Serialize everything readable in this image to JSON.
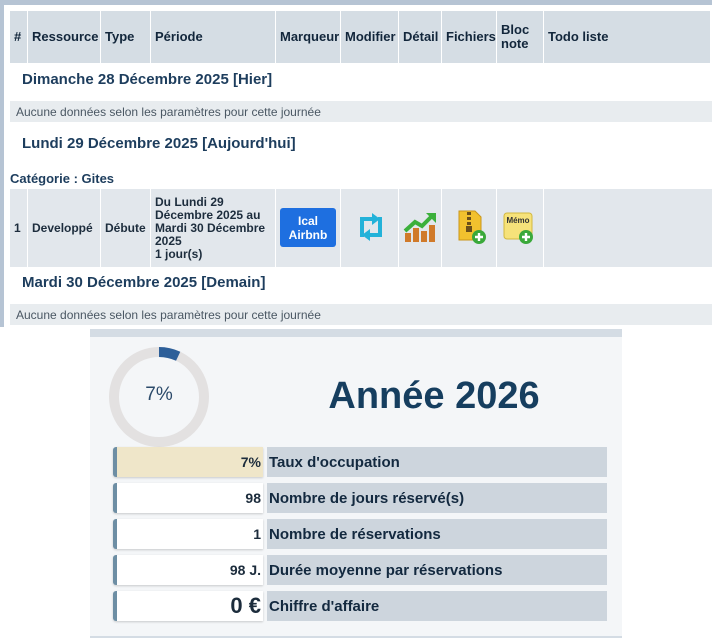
{
  "table": {
    "headers": {
      "num": "#",
      "ressource": "Ressource",
      "type": "Type",
      "periode": "Période",
      "marqueur": "Marqueur",
      "modifier": "Modifier",
      "detail": "Détail",
      "fichiers": "Fichiers",
      "bloc_note_1": "Bloc",
      "bloc_note_2": "note",
      "todo": "Todo liste"
    },
    "day1": {
      "title": "Dimanche 28 Décembre 2025 [Hier]",
      "empty": "Aucune données selon les paramètres pour cette journée"
    },
    "day2": {
      "title": "Lundi 29 Décembre 2025 [Aujourd'hui]",
      "category": "Catégorie : Gites"
    },
    "row": {
      "num": "1",
      "ressource": "Developpé",
      "type": "Débute",
      "periode_l1": "Du Lundi 29",
      "periode_l2": "Décembre 2025 au",
      "periode_l3": "Mardi 30 Décembre",
      "periode_l4": "2025",
      "periode_l5": "1 jour(s)",
      "marqueur_l1": "Ical",
      "marqueur_l2": "Airbnb",
      "memo_label": "Mémo",
      "icons": [
        "sync-arrows-icon",
        "chart-trend-icon",
        "zip-file-add-icon",
        "memo-add-icon"
      ]
    },
    "day3": {
      "title": "Mardi 30 Décembre 2025 [Demain]",
      "empty": "Aucune données selon les paramètres pour cette journée"
    }
  },
  "stats": {
    "gauge_label": "7%",
    "gauge_percent": 7,
    "year_title": "Année 2026",
    "items": [
      {
        "value": "7%",
        "label": "Taux d'occupation"
      },
      {
        "value": "98",
        "label": "Nombre de jours réservé(s)"
      },
      {
        "value": "1",
        "label": "Nombre de réservations"
      },
      {
        "value": "98 J.",
        "label": "Durée moyenne par réservations"
      },
      {
        "value": "0 €",
        "label": "Chiffre d'affaire"
      }
    ]
  },
  "colors": {
    "accent": "#1e6fe0",
    "gauge_fill": "#2d5f99",
    "gauge_track": "#e3e1e1",
    "title_text": "#163e5f"
  }
}
